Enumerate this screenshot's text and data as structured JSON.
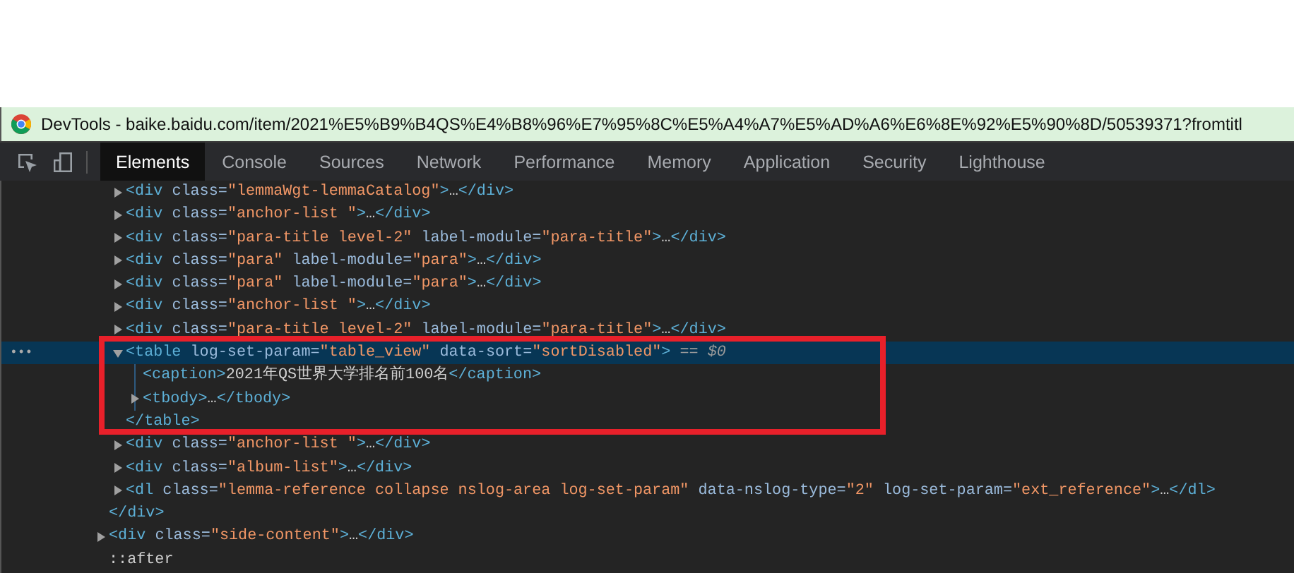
{
  "window": {
    "title": "DevTools - baike.baidu.com/item/2021%E5%B9%B4QS%E4%B8%96%E7%95%8C%E5%A4%A7%E5%AD%A6%E6%8E%92%E5%90%8D/50539371?fromtitl"
  },
  "tabs": [
    {
      "label": "Elements",
      "selected": true
    },
    {
      "label": "Console",
      "selected": false
    },
    {
      "label": "Sources",
      "selected": false
    },
    {
      "label": "Network",
      "selected": false
    },
    {
      "label": "Performance",
      "selected": false
    },
    {
      "label": "Memory",
      "selected": false
    },
    {
      "label": "Application",
      "selected": false
    },
    {
      "label": "Security",
      "selected": false
    },
    {
      "label": "Lighthouse",
      "selected": false
    }
  ],
  "dom_tree": [
    {
      "kind": "branch",
      "close": "</div>",
      "children": [
        {
          "kind": "branch",
          "open": "<div class=\"lemmaWgt-lemmaCatalog\">…</div>",
          "expanded": false,
          "selected": false
        },
        {
          "kind": "branch",
          "open": "<div class=\"anchor-list \">…</div>",
          "expanded": false,
          "selected": false
        },
        {
          "kind": "branch",
          "open": "<div class=\"para-title level-2\" label-module=\"para-title\">…</div>",
          "expanded": false,
          "selected": false
        },
        {
          "kind": "branch",
          "open": "<div class=\"para\" label-module=\"para\">…</div>",
          "expanded": false,
          "selected": false
        },
        {
          "kind": "branch",
          "open": "<div class=\"para\" label-module=\"para\">…</div>",
          "expanded": false,
          "selected": false
        },
        {
          "kind": "branch",
          "open": "<div class=\"anchor-list \">…</div>",
          "expanded": false,
          "selected": false
        },
        {
          "kind": "branch",
          "open": "<div class=\"para-title level-2\" label-module=\"para-title\">…</div>",
          "expanded": false,
          "selected": false
        },
        {
          "kind": "branch",
          "open": "<table log-set-param=\"table_view\" data-sort=\"sortDisabled\"> == $0",
          "expanded": true,
          "selected": true,
          "more_button": "•••",
          "close": "</table>",
          "children": [
            {
              "kind": "leaf",
              "open": "<caption>2021年QS世界大学排名前100名</caption>",
              "selected": false
            },
            {
              "kind": "branch",
              "open": "<tbody>…</tbody>",
              "expanded": false,
              "selected": false
            }
          ]
        },
        {
          "kind": "branch",
          "open": "<div class=\"anchor-list \">…</div>",
          "expanded": false,
          "selected": false
        },
        {
          "kind": "branch",
          "open": "<div class=\"album-list\">…</div>",
          "expanded": false,
          "selected": false
        },
        {
          "kind": "branch",
          "open": "<dl class=\"lemma-reference collapse nslog-area log-set-param\" data-nslog-type=\"2\" log-set-param=\"ext_reference\">…</dl>",
          "expanded": false,
          "selected": false
        }
      ]
    },
    {
      "kind": "branch",
      "open": "<div class=\"side-content\">…</div>",
      "expanded": false,
      "selected": false
    },
    {
      "kind": "leaf",
      "open": "::after",
      "selected": false
    }
  ]
}
